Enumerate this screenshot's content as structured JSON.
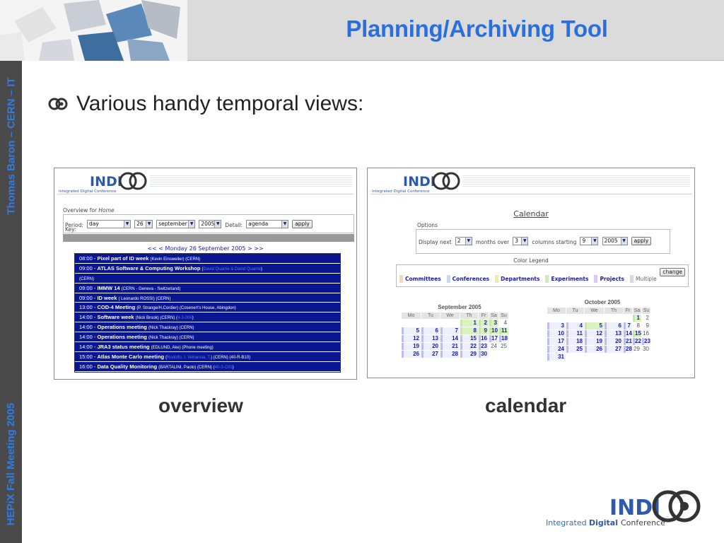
{
  "slide": {
    "title": "Planning/Archiving Tool",
    "side_top": "Thomas Baron – CERN – IT",
    "side_bottom": "HEPiX Fall Meeting 2005",
    "bullet": "Various handy temporal views:",
    "caption_left": "overview",
    "caption_right": "calendar"
  },
  "logo": {
    "indi": "INDI",
    "co": "CO",
    "tag_integrated": "Integrated",
    "tag_digital": "Digital",
    "tag_conference": "Conference"
  },
  "overview": {
    "overview_for": "Overview for",
    "overview_target": "Home",
    "period_label": "Period:",
    "period_value": "day",
    "day_value": "26",
    "month_value": "september",
    "year_value": "2005",
    "detail_label": "Detail:",
    "detail_value": "agenda",
    "apply_label": "apply",
    "key_label": "Key:",
    "nav": "<<  < Monday 26 September 2005 >  >>",
    "events": [
      {
        "time": "08:00 -",
        "title": "Pixel part of ID week",
        "meta": "(Kevin Einsweiler) (CERN)",
        "link": ""
      },
      {
        "time": "09:00 -",
        "title": "ATLAS Software & Computing Workshop",
        "meta": "(",
        "link": "David Quarrie & David Quarrie",
        "tail": ")"
      },
      {
        "time": "",
        "title": "",
        "meta": "(CERN)",
        "link": ""
      },
      {
        "time": "09:00 -",
        "title": "IMMW 14",
        "meta": "(CERN - Geneva - Switzerland)",
        "link": ""
      },
      {
        "time": "09:00 -",
        "title": "ID week",
        "meta": "( Leonardo ROSSI) (CERN)",
        "link": ""
      },
      {
        "time": "13:00 -",
        "title": "COD-4 Meeting",
        "meta": "(P. Strange/H.Cordier) (Cosener\\'s House, Abingdon)",
        "link": ""
      },
      {
        "time": "14:00 -",
        "title": "Software week",
        "meta": "(Nick Brook) (CERN) (",
        "link": "4-3-006",
        "tail": ")"
      },
      {
        "time": "14:00 -",
        "title": "Operations meeting",
        "meta": "(Nick Thackray) (CERN)",
        "link": ""
      },
      {
        "time": "14:00 -",
        "title": "Operations meeting",
        "meta": "(Nick Thackray) (CERN)",
        "link": ""
      },
      {
        "time": "14:00 -",
        "title": "JRA3 status meeting",
        "meta": "(EDLUND, Ake) (Phone meeting)",
        "link": ""
      },
      {
        "time": "15:00 -",
        "title": "Atlas Monte Carlo meeting",
        "meta": "(",
        "link": "Rodolfo, I. Vetransia, T.",
        "tail": ") (CERN) (40-R-B10)"
      },
      {
        "time": "16:00 -",
        "title": "Data Quality Monitoring",
        "meta": "(BARTALINI, Paolo) (CERN) (",
        "link": "40-3-C01",
        "tail": ")"
      }
    ]
  },
  "calendar": {
    "heading": "Calendar",
    "options_label": "Options",
    "display_next": "Display next",
    "months_value": "2",
    "months_over": "months over",
    "columns_value": "3",
    "columns_starting": "columns starting",
    "start_month": "9",
    "start_year": "2005",
    "apply_label": "apply",
    "legend_title": "Color Legend",
    "legend": [
      {
        "label": "Committees",
        "color": "#f0d8c0"
      },
      {
        "label": "Conferences",
        "color": "#c8d8f0"
      },
      {
        "label": "Departments",
        "color": "#f0e8b8"
      },
      {
        "label": "Experiments",
        "color": "#c8f0b0"
      },
      {
        "label": "Projects",
        "color": "#dcc8f0"
      },
      {
        "label": "Multiple",
        "color": "#d8d8d8"
      }
    ],
    "change_label": "change",
    "day_headers": [
      "Mo",
      "Tu",
      "We",
      "Th",
      "Fr",
      "Sa",
      "Su"
    ],
    "months": [
      {
        "title": "September 2005",
        "weeks": [
          [
            "",
            "",
            "",
            "1",
            "2",
            "3",
            "4"
          ],
          [
            "5",
            "6",
            "7",
            "8",
            "9",
            "10",
            "11"
          ],
          [
            "12",
            "13",
            "14",
            "15",
            "16",
            "17",
            "18"
          ],
          [
            "19",
            "20",
            "21",
            "22",
            "23",
            "24",
            "25"
          ],
          [
            "26",
            "27",
            "28",
            "29",
            "30",
            "",
            ""
          ]
        ]
      },
      {
        "title": "October 2005",
        "weeks": [
          [
            "",
            "",
            "",
            "",
            "",
            "1",
            "2"
          ],
          [
            "3",
            "4",
            "5",
            "6",
            "7",
            "8",
            "9"
          ],
          [
            "10",
            "11",
            "12",
            "13",
            "14",
            "15",
            "16"
          ],
          [
            "17",
            "18",
            "19",
            "20",
            "21",
            "22",
            "23"
          ],
          [
            "24",
            "25",
            "26",
            "27",
            "28",
            "29",
            "30"
          ],
          [
            "31",
            "",
            "",
            "",
            "",
            "",
            ""
          ]
        ]
      }
    ]
  }
}
